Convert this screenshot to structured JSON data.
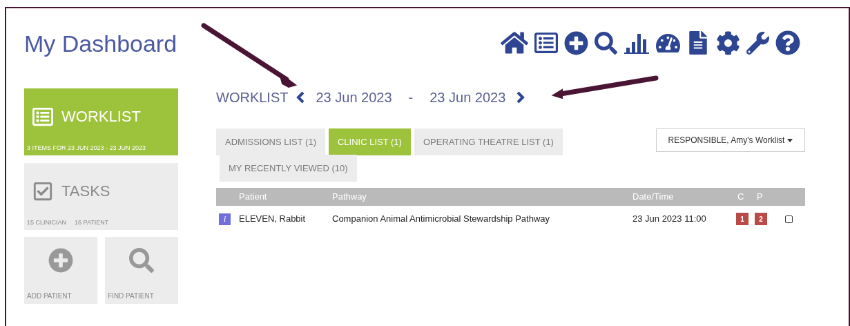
{
  "title": "My Dashboard",
  "tiles": [
    {
      "kind": "worklist",
      "label": "WORKLIST",
      "subtitle": "3 ITEMS FOR 23 JUN 2023 - 23 JUN 2023",
      "selected": true
    },
    {
      "kind": "tasks",
      "label": "TASKS",
      "counts": [
        "15 CLINICIAN",
        "16 PATIENT"
      ],
      "selected": false
    }
  ],
  "actions": [
    {
      "kind": "add",
      "label": "ADD PATIENT"
    },
    {
      "kind": "find",
      "label": "FIND PATIENT"
    }
  ],
  "worklist": {
    "heading": "WORKLIST",
    "date_from": "23 Jun 2023",
    "separator": "-",
    "date_to": "23 Jun 2023"
  },
  "tabs": [
    {
      "label": "ADMISSIONS LIST (1)",
      "selected": false
    },
    {
      "label": "CLINIC LIST (1)",
      "selected": true
    },
    {
      "label": "OPERATING THEATRE LIST (1)",
      "selected": false
    },
    {
      "label": "MY RECENTLY VIEWED (10)",
      "selected": false
    }
  ],
  "worklist_select": {
    "value": "RESPONSIBLE, Amy's Worklist"
  },
  "table": {
    "columns": [
      "Patient",
      "Pathway",
      "Date/Time",
      "C",
      "P"
    ],
    "rows": [
      {
        "info": "i",
        "patient": "ELEVEN, Rabbit",
        "pathway": "Companion Animal Antimicrobial Stewardship Pathway",
        "datetime": "23 Jun 2023 11:00",
        "c": "1",
        "p": "2",
        "checked": false
      }
    ]
  }
}
